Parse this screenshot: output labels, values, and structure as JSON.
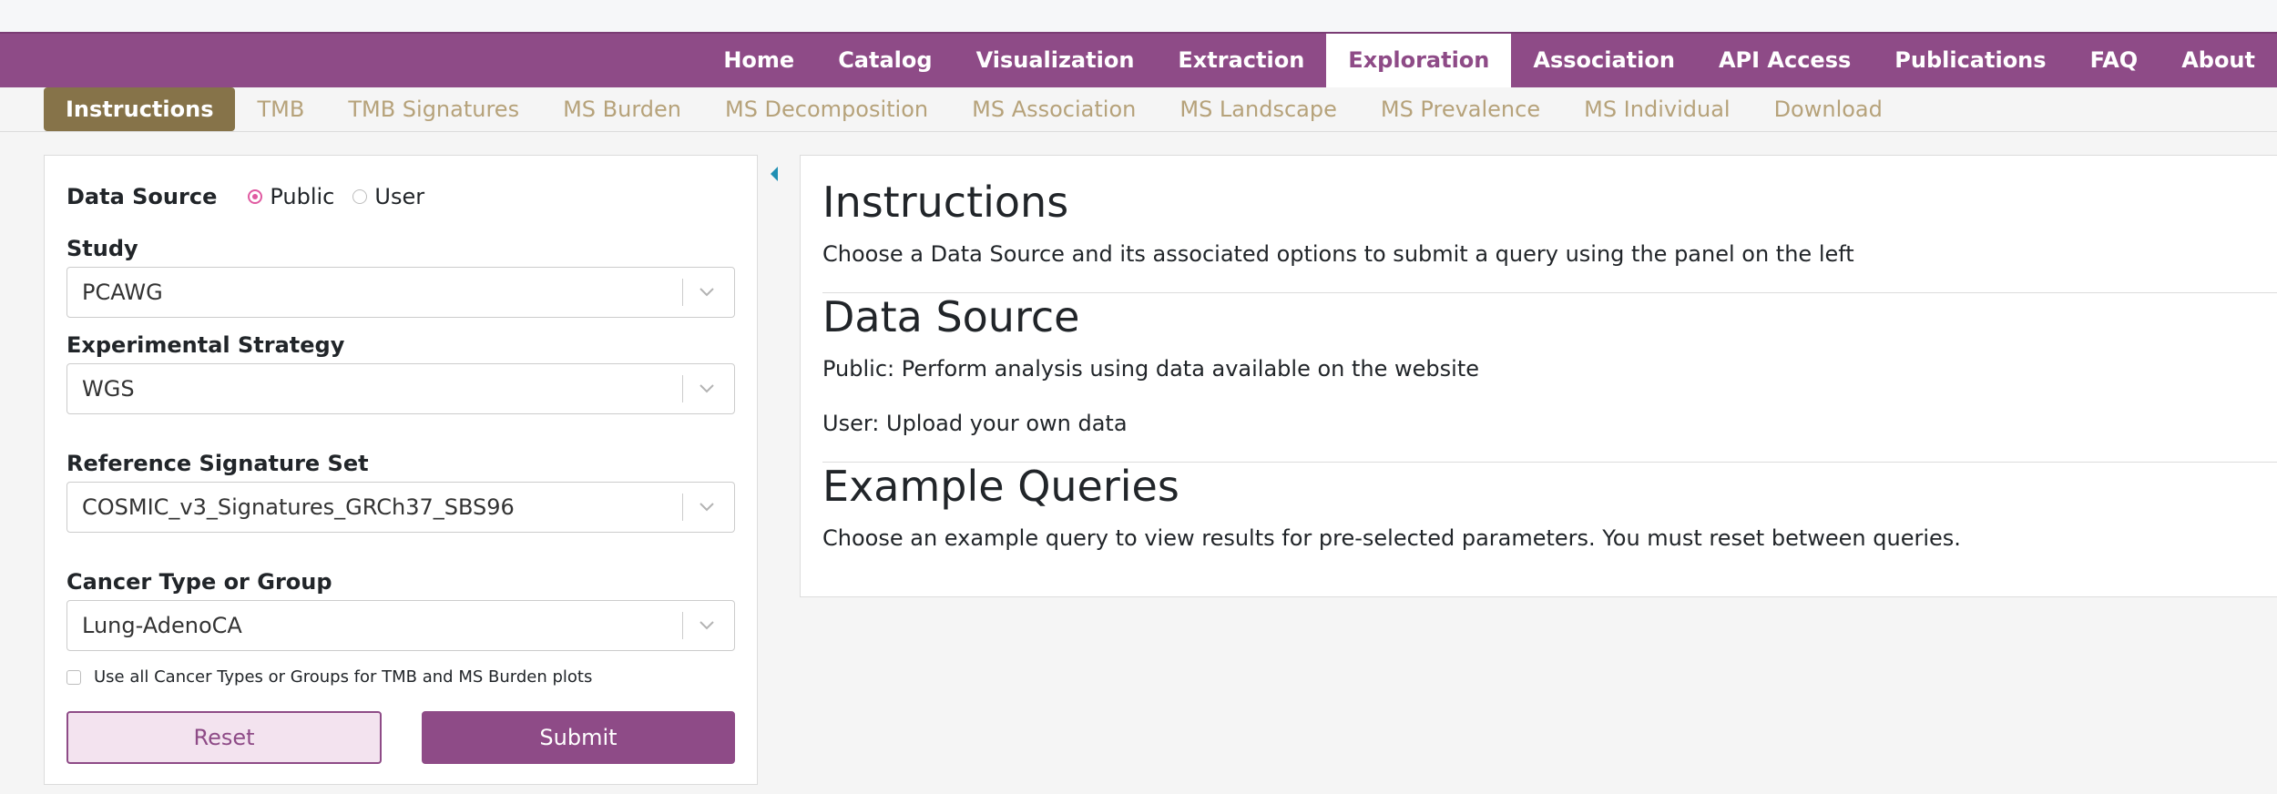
{
  "nav": {
    "items": [
      "Home",
      "Catalog",
      "Visualization",
      "Extraction",
      "Exploration",
      "Association",
      "API Access",
      "Publications",
      "FAQ",
      "About"
    ],
    "active": "Exploration"
  },
  "subnav": {
    "items": [
      "Instructions",
      "TMB",
      "TMB Signatures",
      "MS Burden",
      "MS Decomposition",
      "MS Association",
      "MS Landscape",
      "MS Prevalence",
      "MS Individual",
      "Download"
    ],
    "active": "Instructions"
  },
  "form": {
    "data_source_label": "Data Source",
    "radio_public": "Public",
    "radio_user": "User",
    "selected_source": "Public",
    "study_label": "Study",
    "study_value": "PCAWG",
    "strategy_label": "Experimental Strategy",
    "strategy_value": "WGS",
    "signature_label": "Reference Signature Set",
    "signature_value": "COSMIC_v3_Signatures_GRCh37_SBS96",
    "cancer_label": "Cancer Type or Group",
    "cancer_value": "Lung-AdenoCA",
    "checkbox_label": "Use all Cancer Types or Groups for TMB and MS Burden plots",
    "checkbox_checked": false,
    "reset_label": "Reset",
    "submit_label": "Submit"
  },
  "content": {
    "instructions_title": "Instructions",
    "instructions_text": "Choose a Data Source and its associated options to submit a query using the panel on the left",
    "data_source_title": "Data Source",
    "public_text": "Public: Perform analysis using data available on the website",
    "user_text": "User: Upload your own data",
    "example_title": "Example Queries",
    "example_text": "Choose an example query to view results for pre-selected parameters. You must reset between queries."
  },
  "colors": {
    "brand": "#8e4b87",
    "subnav_active": "#867349",
    "subnav_text": "#b6a27a",
    "radio_accent": "#e05aa1"
  }
}
